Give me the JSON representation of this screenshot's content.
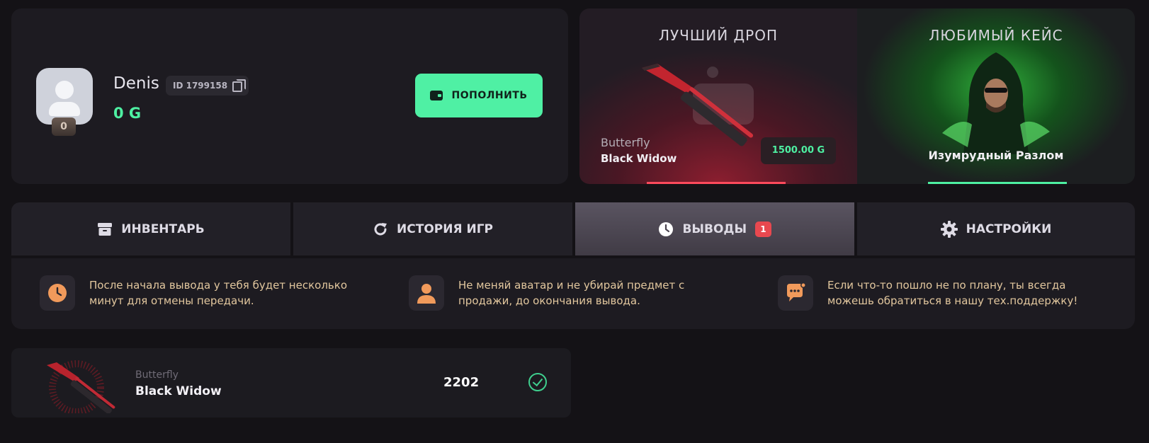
{
  "profile": {
    "username": "Denis",
    "user_id": "ID 1799158",
    "balance": "0 G",
    "level": "0",
    "topup_label": "ПОПОЛНИТЬ"
  },
  "best_drop": {
    "title": "ЛУЧШИЙ ДРОП",
    "item_type": "Butterfly",
    "item_name": "Black Widow",
    "price": "1500.00 G"
  },
  "favorite_case": {
    "title": "ЛЮБИМЫЙ КЕЙС",
    "name": "Изумрудный Разлом"
  },
  "tabs": [
    {
      "label": "ИНВЕНТАРЬ"
    },
    {
      "label": "ИСТОРИЯ ИГР"
    },
    {
      "label": "ВЫВОДЫ",
      "badge": "1",
      "active": true
    },
    {
      "label": "НАСТРОЙКИ"
    }
  ],
  "tips": [
    {
      "text": "После начала вывода у тебя будет несколько минут для отмены передачи."
    },
    {
      "text": "Не меняй аватар и не убирай предмет с продажи, до окончания вывода."
    },
    {
      "text": "Если что-то пошло не по плану, ты всегда можешь обратиться в нашу тех.поддержку!"
    }
  ],
  "withdrawal": {
    "item_type": "Butterfly",
    "item_name": "Black Widow",
    "amount": "2202",
    "status": "completed"
  },
  "colors": {
    "accent": "#4ff0a4",
    "badge": "#e8484f",
    "tip_text": "#e2c79e",
    "tip_icon": "#f19a5b"
  }
}
